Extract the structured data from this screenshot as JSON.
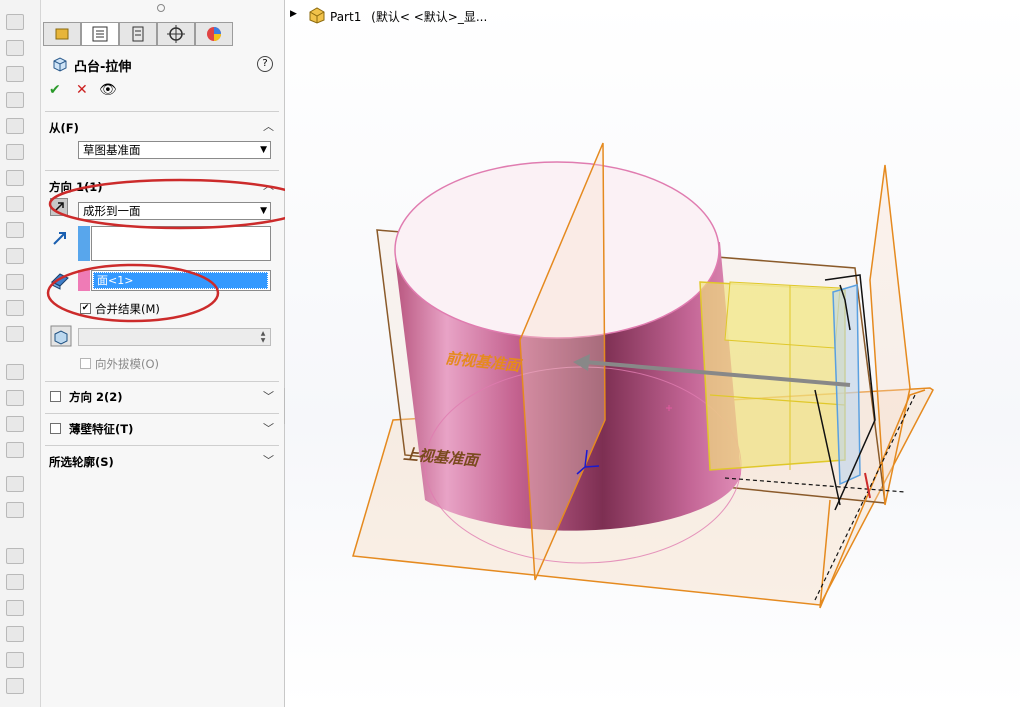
{
  "tree": {
    "part_label": "Part1",
    "config_label": "(默认< <默认>_显..."
  },
  "feature": {
    "title": "凸台-拉伸",
    "help_glyph": "?"
  },
  "actions": {
    "ok_glyph": "✔",
    "cancel_glyph": "✕",
    "preview_glyph": "👁"
  },
  "tabs": [
    "feature-manager-tab",
    "property-manager-tab",
    "configuration-manager-tab",
    "dimxpert-tab",
    "display-manager-tab"
  ],
  "from_section": {
    "label": "从(F)",
    "value": "草图基准面"
  },
  "direction1": {
    "label": "方向 1(1)",
    "end_condition": "成形到一面",
    "face_item": "面<1>",
    "merge_label": "合并结果(M)",
    "merge_checked": true,
    "draft_outward_label": "向外拔模(O)"
  },
  "direction2": {
    "label": "方向 2(2)"
  },
  "thin_feature": {
    "label": "薄壁特征(T)"
  },
  "selected_contours": {
    "label": "所选轮廓(S)"
  },
  "viewport": {
    "front_plane_label": "前视基准面",
    "top_plane_label": "上视基准面"
  },
  "colors": {
    "cylinder": "#c96b9a",
    "plane": "#e58a1f",
    "box": "#f0e27a",
    "annotation_red": "#cc2b2b"
  }
}
